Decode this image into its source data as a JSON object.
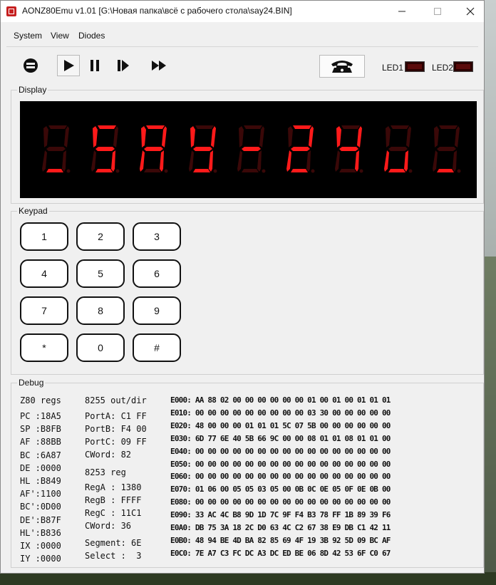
{
  "window": {
    "title": "AONZ80Emu v1.01 [G:\\Новая папка\\всё с рабочего стола\\say24.BIN]",
    "minimize_icon": "minimize-icon",
    "maximize_icon": "maximize-icon",
    "close_icon": "close-icon"
  },
  "menu": [
    "System",
    "View",
    "Diodes"
  ],
  "toolbar": {
    "icons": [
      "stop-icon",
      "play-icon",
      "pause-icon",
      "step-icon",
      "fast-forward-icon",
      "telephone-icon"
    ],
    "led1_label": "LED1",
    "led2_label": "LED2",
    "led_color": "#5a0a0a"
  },
  "display": {
    "label": "Display",
    "text": "_SAY-24u_",
    "digit_color_on": "#ff1a1a",
    "digit_color_off": "#3a0808"
  },
  "keypad": {
    "label": "Keypad",
    "keys": [
      "1",
      "2",
      "3",
      "4",
      "5",
      "6",
      "7",
      "8",
      "9",
      "*",
      "0",
      "#"
    ]
  },
  "debug": {
    "label": "Debug",
    "z80_header": "Z80 regs",
    "z80": [
      "PC :18A5",
      "SP :B8FB",
      "AF :88BB",
      "BC :6A87",
      "DE :0000",
      "HL :B849",
      "AF':1100",
      "BC':0D00",
      "DE':B87F",
      "HL':B836",
      "IX :0000",
      "IY :0000"
    ],
    "i8255_header": "8255 out/dir",
    "i8255": [
      "PortA: C1 FF",
      "PortB: F4 00",
      "PortC: 09 FF",
      "CWord: 82"
    ],
    "i8253_header": "8253 reg",
    "i8253": [
      "RegA : 1380",
      "RegB : FFFF",
      "RegC : 11C1",
      "CWord: 36"
    ],
    "segment": "Segment: 6E",
    "select": "Select :  3",
    "memory": [
      "E000: AA 88 02 00 00 00 00 00 00 01 00 01 00 01 01 01",
      "E010: 00 00 00 00 00 00 00 00 00 03 30 00 00 00 00 00",
      "E020: 48 00 00 00 01 01 01 5C 07 5B 00 00 00 00 00 00",
      "E030: 6D 77 6E 40 5B 66 9C 00 00 08 01 01 08 01 01 00",
      "E040: 00 00 00 00 00 00 00 00 00 00 00 00 00 00 00 00",
      "E050: 00 00 00 00 00 00 00 00 00 00 00 00 00 00 00 00",
      "E060: 00 00 00 00 00 00 00 00 00 00 00 00 00 00 00 00",
      "E070: 01 06 00 05 05 03 05 00 0B 0C 0E 05 0F 0E 0B 00",
      "E080: 00 00 00 00 00 00 00 00 00 00 00 00 00 00 00 00",
      "E090: 33 AC 4C B8 9D 1D 7C 9F F4 B3 78 FF 1B 89 39 F6",
      "E0A0: DB 75 3A 18 2C D0 63 4C C2 67 38 E9 DB C1 42 11",
      "E0B0: 48 94 BE 4D BA 82 85 69 4F 19 3B 92 5D 09 BC AF",
      "E0C0: 7E A7 C3 FC DC A3 DC ED BE 06 8D 42 53 6F C0 67"
    ]
  }
}
